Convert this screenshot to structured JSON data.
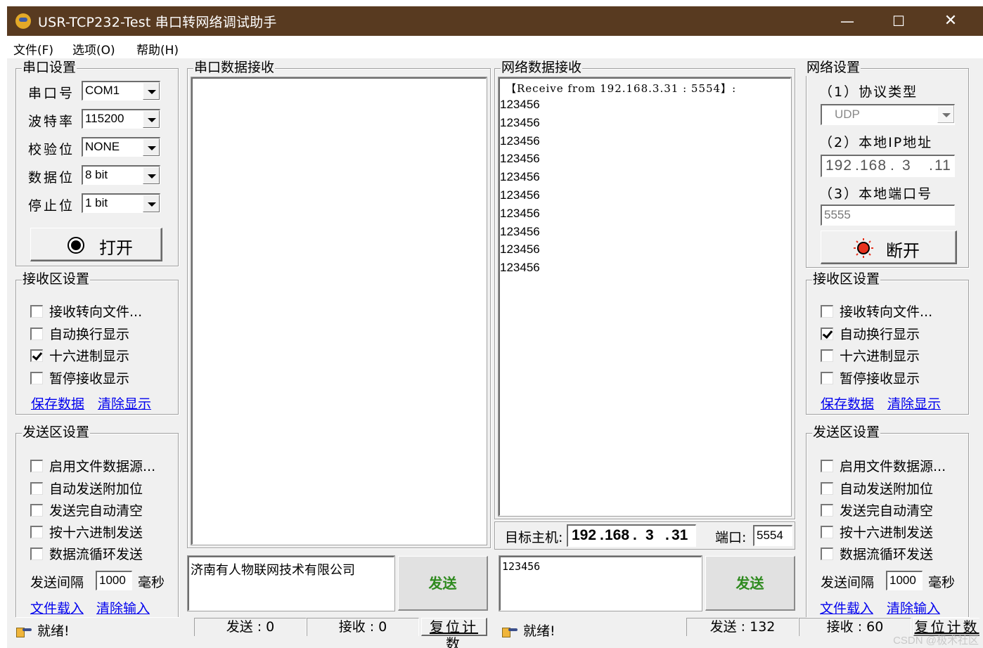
{
  "window": {
    "title": "USR-TCP232-Test 串口转网络调试助手",
    "controls": {
      "minimize": "—",
      "maximize": "☐",
      "close": "✕"
    },
    "accent_color": "#583a20"
  },
  "menu": [
    "文件(F)",
    "选项(O)",
    "帮助(H)"
  ],
  "serial_settings": {
    "title": "串口设置",
    "fields": [
      {
        "label": "串口号",
        "value": "COM1"
      },
      {
        "label": "波特率",
        "value": "115200"
      },
      {
        "label": "校验位",
        "value": "NONE"
      },
      {
        "label": "数据位",
        "value": "8 bit"
      },
      {
        "label": "停止位",
        "value": "1 bit"
      }
    ],
    "open_button": "打开"
  },
  "serial_receive_settings": {
    "title": "接收区设置",
    "options": [
      {
        "label": "接收转向文件...",
        "checked": false
      },
      {
        "label": "自动换行显示",
        "checked": false
      },
      {
        "label": "十六进制显示",
        "checked": true
      },
      {
        "label": "暂停接收显示",
        "checked": false
      }
    ],
    "save_link": "保存数据",
    "clear_link": "清除显示"
  },
  "serial_send_settings": {
    "title": "发送区设置",
    "options": [
      {
        "label": "启用文件数据源...",
        "checked": false
      },
      {
        "label": "自动发送附加位",
        "checked": false
      },
      {
        "label": "发送完自动清空",
        "checked": false
      },
      {
        "label": "按十六进制发送",
        "checked": false
      },
      {
        "label": "数据流循环发送",
        "checked": false
      }
    ],
    "interval_label": "发送间隔",
    "interval_value": "1000",
    "interval_unit": "毫秒",
    "load_link": "文件载入",
    "clear_link": "清除输入"
  },
  "serial_receive": {
    "title": "串口数据接收",
    "content": ""
  },
  "serial_send": {
    "input_value": "济南有人物联网技术有限公司",
    "send_button": "发送"
  },
  "serial_status": {
    "status_text": "就绪!",
    "sent": "发送 : 0",
    "received": "接收 : 0",
    "reset_button": "复位计数"
  },
  "network_receive": {
    "title": "网络数据接收",
    "header": "【Receive from 192.168.3.31 : 5554】:",
    "lines": [
      "123456",
      "123456",
      "123456",
      "123456",
      "123456",
      "123456",
      "123456",
      "123456",
      "123456",
      "123456"
    ]
  },
  "target": {
    "host_label": "目标主机:",
    "host_octets": [
      "192",
      "168",
      "3",
      "31"
    ],
    "port_label": "端口:",
    "port_value": "5554"
  },
  "network_send": {
    "input_value": "123456",
    "send_button": "发送"
  },
  "network_status": {
    "status_text": "就绪!",
    "sent": "发送 : 132",
    "received": "接收 : 60",
    "reset_button": "复位计数"
  },
  "network_settings": {
    "title": "网络设置",
    "protocol_label": "（1）协议类型",
    "protocol_value": "UDP",
    "local_ip_label": "（2）本地IP地址",
    "local_ip_octets": [
      "192",
      "168",
      "3",
      "11"
    ],
    "local_port_label": "（3）本地端口号",
    "local_port_value": "5555",
    "disconnect_button": "断开",
    "indicator_color": "#e8321e"
  },
  "network_receive_settings": {
    "title": "接收区设置",
    "options": [
      {
        "label": "接收转向文件...",
        "checked": false
      },
      {
        "label": "自动换行显示",
        "checked": true
      },
      {
        "label": "十六进制显示",
        "checked": false
      },
      {
        "label": "暂停接收显示",
        "checked": false
      }
    ],
    "save_link": "保存数据",
    "clear_link": "清除显示"
  },
  "network_send_settings": {
    "title": "发送区设置",
    "options": [
      {
        "label": "启用文件数据源...",
        "checked": false
      },
      {
        "label": "自动发送附加位",
        "checked": false
      },
      {
        "label": "发送完自动清空",
        "checked": false
      },
      {
        "label": "按十六进制发送",
        "checked": false
      },
      {
        "label": "数据流循环发送",
        "checked": false
      }
    ],
    "interval_label": "发送间隔",
    "interval_value": "1000",
    "interval_unit": "毫秒",
    "load_link": "文件载入",
    "clear_link": "清除输入"
  },
  "watermark": "CSDN @极术社区"
}
